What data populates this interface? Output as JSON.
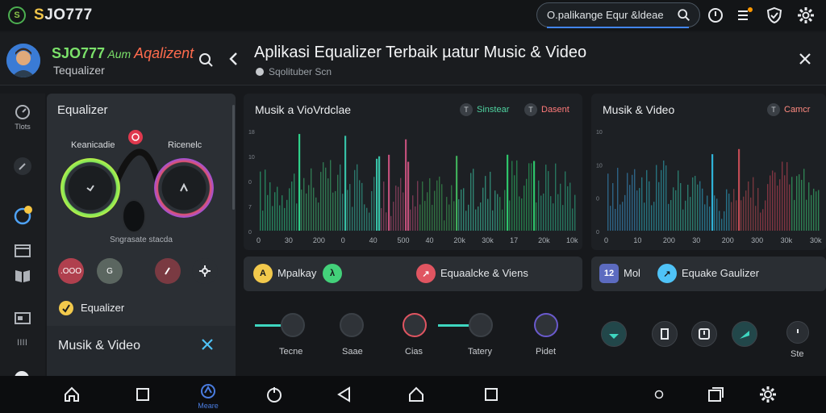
{
  "topbar": {
    "brand_logo": "S",
    "brand_name_a": "S",
    "brand_name_b": "JO777",
    "search_value": "O.palikange Equr &ldeae",
    "icons": [
      "search-icon",
      "clock-icon",
      "notification-icon",
      "shield-icon",
      "settings-icon"
    ]
  },
  "header": {
    "app_title_a": "SJO777",
    "app_title_b": " Aum ",
    "app_title_c": "Aqalizent",
    "app_sub": "Tequalizer",
    "page_title": "Aplikasi Equalizer Terbaik µatur Music & Video",
    "page_sub": "Sqolituber Scn"
  },
  "rail": {
    "items": [
      "Tlots",
      "",
      "",
      "",
      "",
      "",
      "llll"
    ]
  },
  "left_panel": {
    "title": "Equalizer",
    "knob_left_label": "Keanicadie",
    "knob_right_label": "Ricenelc",
    "caption": "Sngrasate stacda",
    "btn_1": ".OOO",
    "btn_2": "G",
    "btn_3": "",
    "eq_label": "Equalizer",
    "music_label": "Musik & Video"
  },
  "chart1": {
    "title": "Musik a VioVrdclae",
    "legend_1": "Sinstear",
    "legend_2": "Dasent",
    "legend_1_color": "#4fd3a0",
    "legend_2_color": "#ff7a7a",
    "x_ticks": [
      "0",
      "30",
      "200",
      "0",
      "40",
      "500",
      "40",
      "20k",
      "30k",
      "17",
      "20k",
      "10k"
    ],
    "y_ticks": [
      "18",
      "10",
      "0",
      "7",
      "0"
    ]
  },
  "chart2": {
    "title": "Musik & Video",
    "legend_1": "Camcr",
    "legend_1_color": "#ff8a80",
    "x_ticks": [
      "0",
      "10",
      "200",
      "30",
      "200",
      "300",
      "30k",
      "30k"
    ],
    "y_ticks": [
      "10",
      "10",
      "0",
      "0"
    ]
  },
  "control_bar_1": {
    "label_1": "Mpalkay",
    "label_2": "Equaalcke & Viens",
    "chip_1_color": "#f2c94c",
    "chip_2_color": "#43d17a",
    "chip_3_color": "#e05561"
  },
  "control_bar_2": {
    "label_1": "Mol",
    "label_2": "Equake Gaulizer",
    "chip_1_color": "#5c6bc0",
    "chip_2_color": "#4fc3f7"
  },
  "bottom_controls": {
    "labels": [
      "Tecne",
      "Saae",
      "Cias",
      "Tatery",
      "Pidet",
      "Ste"
    ]
  },
  "navbar": {
    "active_label": "Meare"
  }
}
